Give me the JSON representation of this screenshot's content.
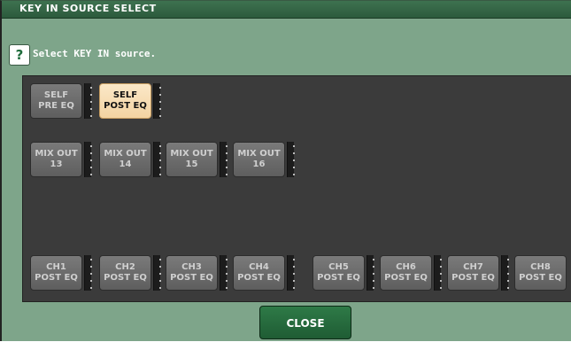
{
  "window": {
    "title": "KEY IN SOURCE SELECT",
    "prompt": "Select KEY IN source.",
    "help_icon": "question-mark-icon"
  },
  "buttons": {
    "self": [
      {
        "label": "SELF\nPRE EQ",
        "selected": false
      },
      {
        "label": "SELF\nPOST EQ",
        "selected": true
      }
    ],
    "mix_out": [
      {
        "label": "MIX OUT\n13"
      },
      {
        "label": "MIX OUT\n14"
      },
      {
        "label": "MIX OUT\n15"
      },
      {
        "label": "MIX OUT\n16"
      }
    ],
    "channels": [
      {
        "label": "CH1\nPOST EQ"
      },
      {
        "label": "CH2\nPOST EQ"
      },
      {
        "label": "CH3\nPOST EQ"
      },
      {
        "label": "CH4\nPOST EQ"
      },
      {
        "label": "CH5\nPOST EQ"
      },
      {
        "label": "CH6\nPOST EQ"
      },
      {
        "label": "CH7\nPOST EQ"
      },
      {
        "label": "CH8\nPOST EQ"
      }
    ]
  },
  "footer": {
    "close_label": "CLOSE"
  },
  "colors": {
    "window_bg": "#7ea58a",
    "panel_bg": "#3b3b3b",
    "selected_bg": "#f3d3a2",
    "close_bg": "#2e7a47"
  }
}
